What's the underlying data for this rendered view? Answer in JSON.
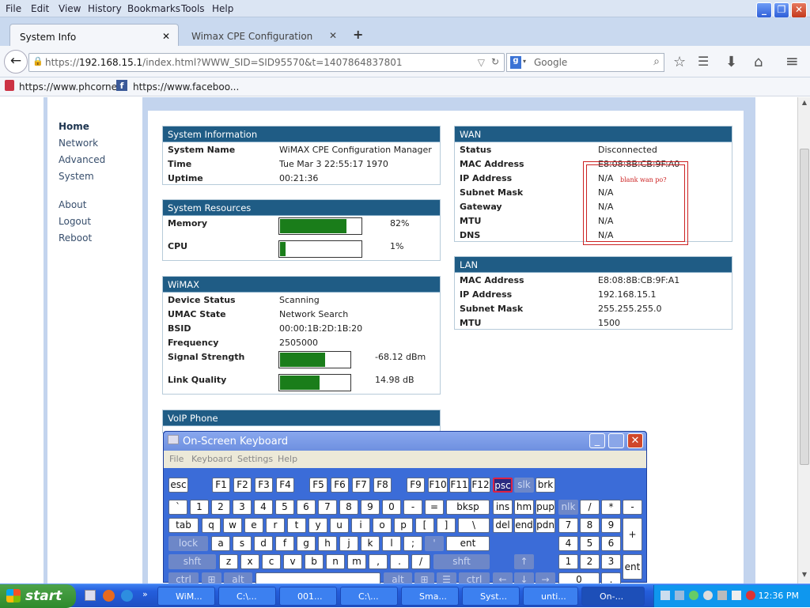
{
  "menu": [
    "File",
    "Edit",
    "View",
    "History",
    "Bookmarks",
    "Tools",
    "Help"
  ],
  "tabs": [
    {
      "label": "System Info"
    },
    {
      "label": "Wimax CPE Configuration"
    }
  ],
  "url": {
    "protocol": "https://",
    "host": "192.168.15.1",
    "path": "/index.html?WWW_SID=SID95570&t=1407864837801"
  },
  "search_placeholder": "Google",
  "bookmarks": [
    "https://www.phcorne...",
    "https://www.faceboo..."
  ],
  "side_nav": {
    "main": [
      "Home",
      "Network",
      "Advanced",
      "System"
    ],
    "extra": [
      "About",
      "Logout",
      "Reboot"
    ]
  },
  "system_info": {
    "title": "System Information",
    "rows": [
      {
        "k": "System Name",
        "v": "WiMAX CPE Configuration Manager"
      },
      {
        "k": "Time",
        "v": "Tue Mar 3 22:55:17 1970"
      },
      {
        "k": "Uptime",
        "v": "00:21:36"
      }
    ]
  },
  "resources": {
    "title": "System Resources",
    "rows": [
      {
        "k": "Memory",
        "v": "82%",
        "level": 0.82
      },
      {
        "k": "CPU",
        "v": "1%",
        "level": 0.01
      }
    ]
  },
  "wimax": {
    "title": "WiMAX",
    "rows": [
      {
        "k": "Device Status",
        "v": "Scanning"
      },
      {
        "k": "UMAC State",
        "v": "Network Search"
      },
      {
        "k": "BSID",
        "v": "00:00:1B:2D:1B:20"
      },
      {
        "k": "Frequency",
        "v": "2505000"
      }
    ],
    "bars": [
      {
        "k": "Signal Strength",
        "v": "-68.12 dBm",
        "level": 0.65
      },
      {
        "k": "Link Quality",
        "v": "14.98 dB",
        "level": 0.57
      }
    ]
  },
  "voip": {
    "title": "VoIP Phone"
  },
  "wan": {
    "title": "WAN",
    "rows": [
      {
        "k": "Status",
        "v": "Disconnected"
      },
      {
        "k": "MAC Address",
        "v": "E8:08:8B:CB:9F:A0"
      },
      {
        "k": "IP Address",
        "v": "N/A"
      },
      {
        "k": "Subnet Mask",
        "v": "N/A"
      },
      {
        "k": "Gateway",
        "v": "N/A"
      },
      {
        "k": "MTU",
        "v": "N/A"
      },
      {
        "k": "DNS",
        "v": "N/A"
      }
    ]
  },
  "annotation": "blank wan po?",
  "lan": {
    "title": "LAN",
    "rows": [
      {
        "k": "MAC Address",
        "v": "E8:08:8B:CB:9F:A1"
      },
      {
        "k": "IP Address",
        "v": "192.168.15.1"
      },
      {
        "k": "Subnet Mask",
        "v": "255.255.255.0"
      },
      {
        "k": "MTU",
        "v": "1500"
      }
    ]
  },
  "osk": {
    "title": "On-Screen Keyboard",
    "menu": [
      "File",
      "Keyboard",
      "Settings",
      "Help"
    ]
  },
  "taskbar": {
    "start": "start",
    "tasks": [
      "WiM...",
      "C:\\...",
      "001...",
      "C:\\...",
      "Sma...",
      "Syst...",
      "unti...",
      "On-..."
    ],
    "clock": "12:36 PM"
  },
  "colors": {
    "header": "#1f5c85",
    "bar": "#1a7d1a",
    "annotation": "#cc2222"
  }
}
